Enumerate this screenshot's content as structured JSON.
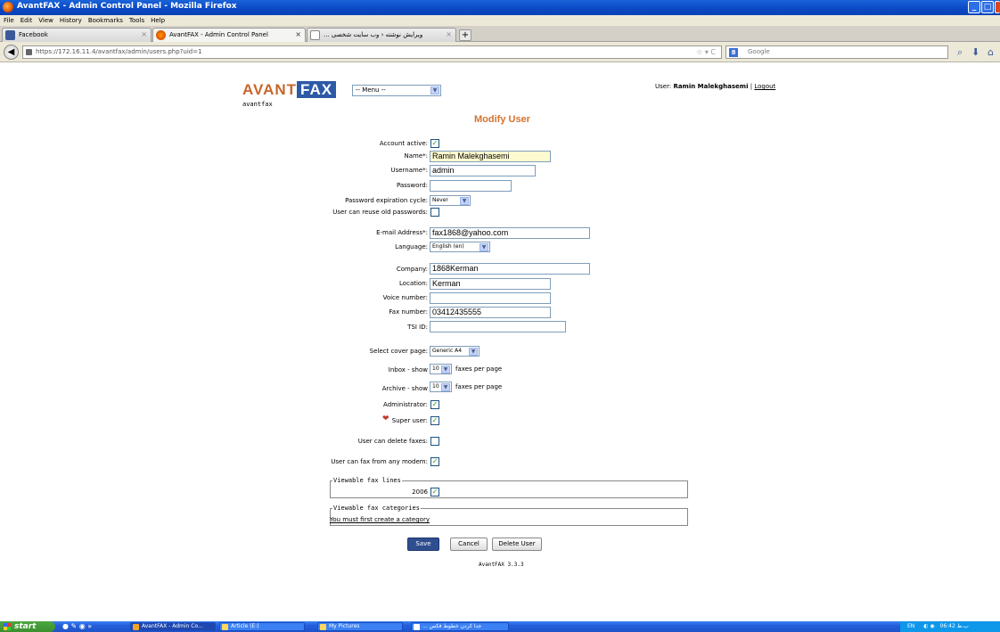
{
  "window": {
    "title": "AvantFAX - Admin Control Panel - Mozilla Firefox"
  },
  "menubar": [
    "File",
    "Edit",
    "View",
    "History",
    "Bookmarks",
    "Tools",
    "Help"
  ],
  "tabs": [
    {
      "label": "Facebook"
    },
    {
      "label": "AvantFAX - Admin Control Panel"
    },
    {
      "label": "... ویرایش نوشته ‹ وب سایت شخصی"
    }
  ],
  "new_tab": "+",
  "nav": {
    "url": "https://172.16.11.4/avantfax/admin/users.php?uid=1",
    "search_placeholder": "Google",
    "search_engine_icon": "8"
  },
  "header": {
    "logo_left": "AVANT",
    "logo_right": "FAX",
    "logo_sub": "avantfax",
    "menu_select": "-- Menu --",
    "user_prefix": "User:",
    "user_name": "Ramin Malekghasemi",
    "separator": "|",
    "logout": "Logout"
  },
  "form": {
    "heading": "Modify User",
    "account_active_label": "Account active:",
    "name_label": "Name*:",
    "name_value": "Ramin Malekghasemi",
    "username_label": "Username*:",
    "username_value": "admin",
    "password_label": "Password:",
    "password_value": "",
    "pw_cycle_label": "Password expiration cycle:",
    "pw_cycle_value": "Never",
    "reuse_label": "User can reuse old passwords:",
    "email_label": "E-mail Address*:",
    "email_value": "fax1868@yahoo.com",
    "language_label": "Language:",
    "language_value": "English (en)",
    "company_label": "Company:",
    "company_value": "1868Kerman",
    "location_label": "Location:",
    "location_value": "Kerman",
    "voice_label": "Voice number:",
    "voice_value": "",
    "fax_label": "Fax number:",
    "fax_value": "03412435555",
    "tsi_label": "TSI ID:",
    "tsi_value": "",
    "cover_label": "Select cover page:",
    "cover_value": "Generic A4",
    "inbox_label": "Inbox - show",
    "inbox_value": "10",
    "archive_label": "Archive - show",
    "archive_value": "10",
    "per_page": "faxes per page",
    "admin_label": "Administrator:",
    "super_label": "Super user:",
    "delete_label": "User can delete faxes:",
    "anymodem_label": "User can fax from any modem:",
    "fax_lines_legend": "Viewable fax lines",
    "fax_line_value": "2006",
    "fax_cat_legend": "Viewable fax categories",
    "fax_cat_link": "You must first create a category",
    "save": "Save",
    "cancel": "Cancel",
    "delete_user": "Delete User",
    "version": "AvantFAX 3.3.3"
  },
  "checkmarks": {
    "account_active": true,
    "reuse": false,
    "admin": true,
    "super": true,
    "delete": false,
    "anymodem": true,
    "fax_line": true
  },
  "taskbar": {
    "start": "start",
    "tasks": [
      "AvantFAX - Admin Co...",
      "Article (E:)",
      "My Pictures",
      "... جدا کردن خطوط فکس"
    ],
    "tray_lang": "EN",
    "clock": "06:42 ب.ظ"
  },
  "colors": {
    "accent": "#d4732f",
    "logo_blue": "#2d5aa7",
    "titlebar": "#0a47c4"
  }
}
